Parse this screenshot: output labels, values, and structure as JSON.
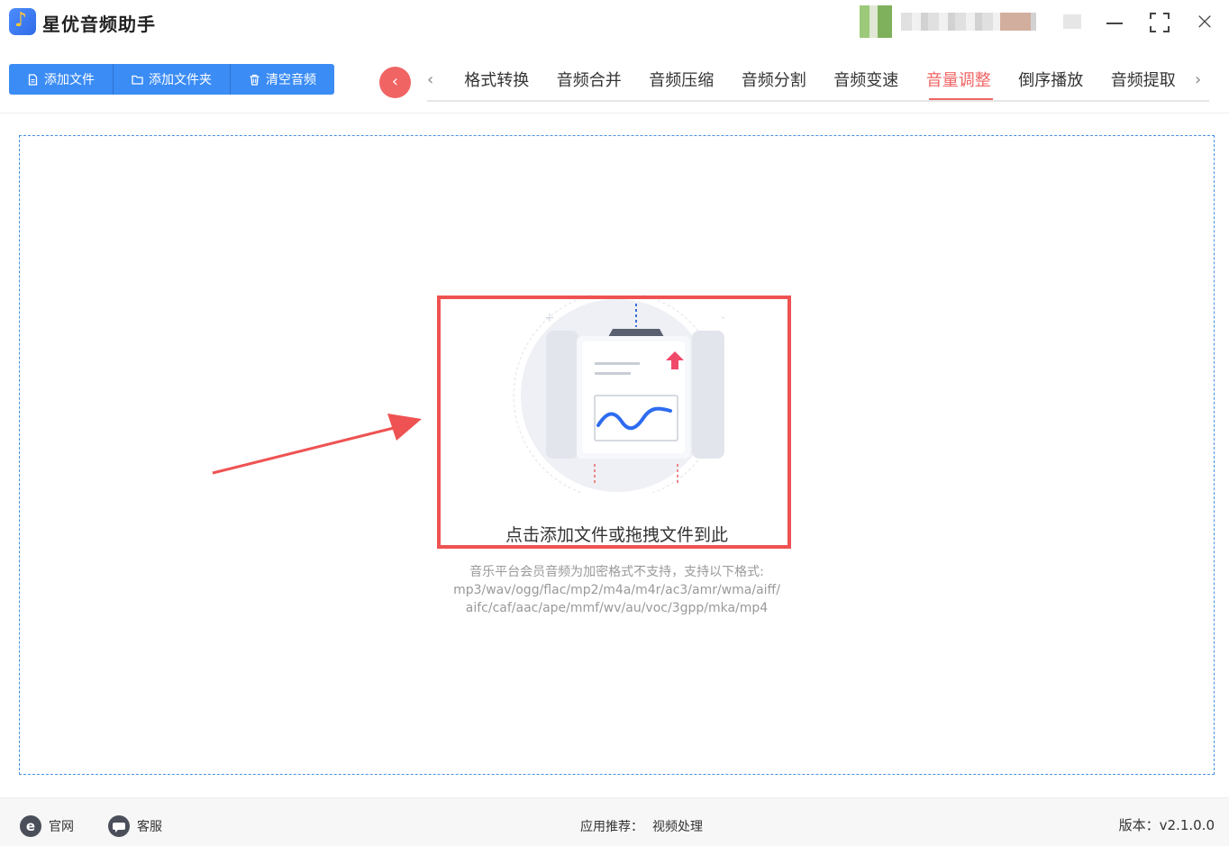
{
  "app": {
    "title": "星优音频助手"
  },
  "window_controls": {
    "close": "×"
  },
  "toolbar": {
    "add_file": "添加文件",
    "add_folder": "添加文件夹",
    "clear_audio": "清空音频"
  },
  "nav": {
    "back": "‹",
    "prev": "‹",
    "next": "›",
    "tabs": [
      {
        "label": "格式转换",
        "active": false
      },
      {
        "label": "音频合并",
        "active": false
      },
      {
        "label": "音频压缩",
        "active": false
      },
      {
        "label": "音频分割",
        "active": false
      },
      {
        "label": "音频变速",
        "active": false
      },
      {
        "label": "音量调整",
        "active": true
      },
      {
        "label": "倒序播放",
        "active": false
      },
      {
        "label": "音频提取",
        "active": false
      }
    ]
  },
  "drop_zone": {
    "prompt": "点击添加文件或拖拽文件到此",
    "note_line1": "音乐平台会员音频为加密格式不支持，支持以下格式:",
    "note_line2": "mp3/wav/ogg/flac/mp2/m4a/m4r/ac3/amr/wma/aiff/",
    "note_line3": "aifc/caf/aac/ape/mmf/wv/au/voc/3gpp/mka/mp4"
  },
  "footer": {
    "website_icon": "e",
    "website": "官网",
    "support": "客服",
    "recommend_label": "应用推荐：",
    "recommend_item": "视频处理",
    "version": "版本：v2.1.0.0"
  },
  "colors": {
    "primary": "#3b8cf5",
    "accent": "#f06464",
    "highlight": "#ef5252"
  }
}
